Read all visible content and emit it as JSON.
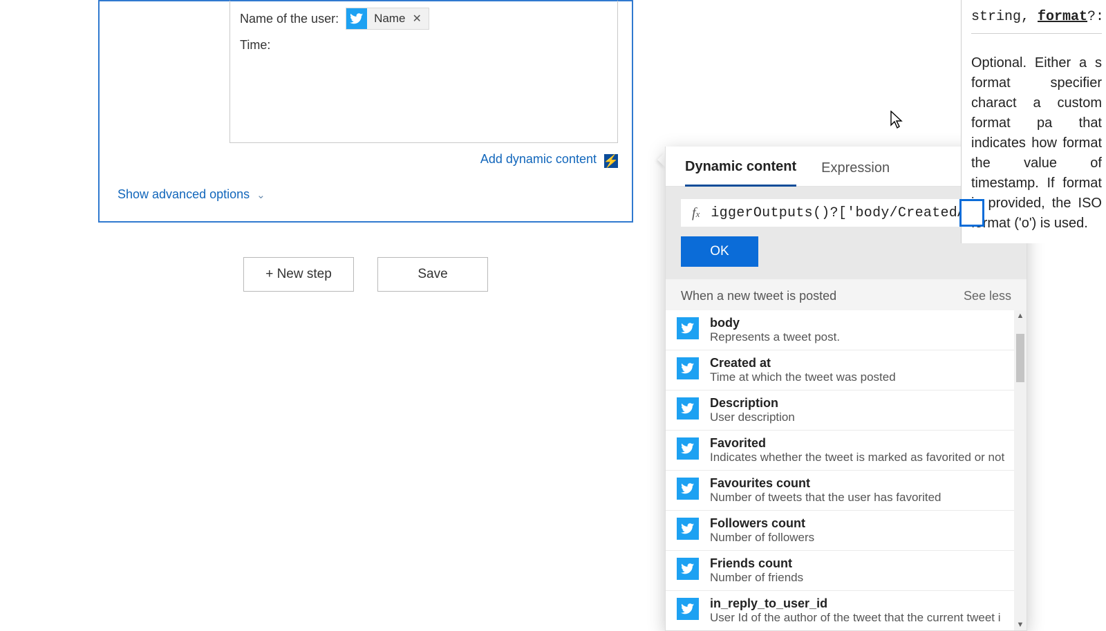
{
  "editor": {
    "user_label": "Name of the user:",
    "time_label": "Time:",
    "token_label": "Name",
    "add_dynamic": "Add dynamic content",
    "advanced": "Show advanced options"
  },
  "buttons": {
    "new_step": "+ New step",
    "save": "Save"
  },
  "popup": {
    "tab_dynamic": "Dynamic content",
    "tab_expression": "Expression",
    "fx_value": "iggerOutputs()?['body/CreatedAtIso'],",
    "ok": "OK",
    "section_title": "When a new tweet is posted",
    "see_less": "See less",
    "items": [
      {
        "title": "body",
        "desc": "Represents a tweet post."
      },
      {
        "title": "Created at",
        "desc": "Time at which the tweet was posted"
      },
      {
        "title": "Description",
        "desc": "User description"
      },
      {
        "title": "Favorited",
        "desc": "Indicates whether the tweet is marked as favorited or not"
      },
      {
        "title": "Favourites count",
        "desc": "Number of tweets that the user has favorited"
      },
      {
        "title": "Followers count",
        "desc": "Number of followers"
      },
      {
        "title": "Friends count",
        "desc": "Number of friends"
      },
      {
        "title": "in_reply_to_user_id",
        "desc": "User Id of the author of the tweet that the current tweet i"
      }
    ]
  },
  "doc": {
    "sig_prefix": "string, ",
    "sig_param": "format",
    "sig_suffix": "?: str",
    "body": "Optional. Either a s format specifier charact a custom format pa that indicates how format the value of timestamp. If format is provided, the ISO format ('o') is used."
  }
}
